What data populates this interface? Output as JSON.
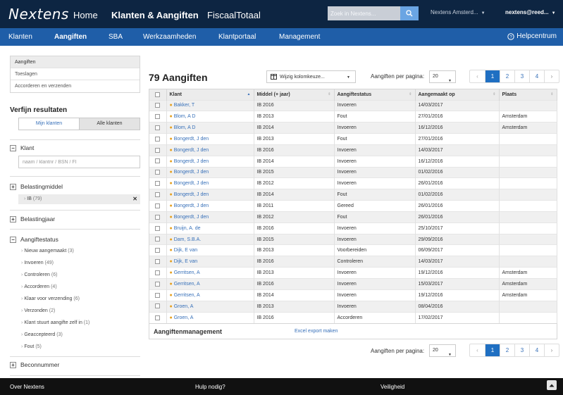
{
  "topbar": {
    "logo": "Nextens",
    "nav": [
      "Home",
      "Klanten & Aangiften",
      "FiscaalTotaal"
    ],
    "search_placeholder": "Zoek in Nextens...",
    "office": "Nextens Amsterd...",
    "user": "nextens@reed..."
  },
  "subnav": {
    "items": [
      "Klanten",
      "Aangiften",
      "SBA",
      "Werkzaamheden",
      "Klantportaal",
      "Management"
    ],
    "help": "Helpcentrum"
  },
  "sidebar": {
    "links": [
      "Aangiften",
      "Toeslagen",
      "Accorderen en verzenden"
    ],
    "refine_title": "Verfijn resultaten",
    "toggle": [
      "Mijn klanten",
      "Alle klanten"
    ],
    "facet_klant": "Klant",
    "klant_placeholder": "naam / klantnr / BSN / FI",
    "facet_belastingmiddel": "Belastingmiddel",
    "selected_filter": "IB",
    "selected_filter_count": "(79)",
    "facet_belastingjaar": "Belastingjaar",
    "facet_aangiftestatus": "Aangiftestatus",
    "statuses": [
      {
        "label": "Nieuw aangemaakt",
        "count": "(3)"
      },
      {
        "label": "Invoeren",
        "count": "(49)"
      },
      {
        "label": "Controleren",
        "count": "(6)"
      },
      {
        "label": "Accorderen",
        "count": "(4)"
      },
      {
        "label": "Klaar voor verzending",
        "count": "(6)"
      },
      {
        "label": "Verzonden",
        "count": "(2)"
      },
      {
        "label": "Klant stuurt aangifte zelf in",
        "count": "(1)"
      },
      {
        "label": "Geaccepteerd",
        "count": "(3)"
      },
      {
        "label": "Fout",
        "count": "(5)"
      }
    ],
    "facet_beconnummer": "Beconnummer"
  },
  "main": {
    "title": "79 Aangiften",
    "column_select": "Wijzig kolomkeuze...",
    "per_page_label": "Aangiften per pagina:",
    "per_page_value": "20",
    "pages": [
      "‹",
      "1",
      "2",
      "3",
      "4",
      "›"
    ],
    "columns": [
      "Klant",
      "Middel (+ jaar)",
      "Aangiftestatus",
      "Aangemaakt op",
      "Plaats"
    ],
    "rows": [
      [
        "Bakker, T",
        "IB 2016",
        "Invoeren",
        "14/03/2017",
        ""
      ],
      [
        "Blom, A D",
        "IB 2013",
        "Fout",
        "27/01/2016",
        "Amsterdam"
      ],
      [
        "Blom, A D",
        "IB 2014",
        "Invoeren",
        "16/12/2016",
        "Amsterdam"
      ],
      [
        "Bongerdt, J den",
        "IB 2013",
        "Fout",
        "27/01/2016",
        ""
      ],
      [
        "Bongerdt, J den",
        "IB 2016",
        "Invoeren",
        "14/03/2017",
        ""
      ],
      [
        "Bongerdt, J den",
        "IB 2014",
        "Invoeren",
        "16/12/2016",
        ""
      ],
      [
        "Bongerdt, J den",
        "IB 2015",
        "Invoeren",
        "01/02/2016",
        ""
      ],
      [
        "Bongerdt, J den",
        "IB 2012",
        "Invoeren",
        "26/01/2016",
        ""
      ],
      [
        "Bongerdt, J den",
        "IB 2014",
        "Fout",
        "01/02/2016",
        ""
      ],
      [
        "Bongerdt, J den",
        "IB 2011",
        "Gereed",
        "26/01/2016",
        ""
      ],
      [
        "Bongerdt, J den",
        "IB 2012",
        "Fout",
        "26/01/2016",
        ""
      ],
      [
        "Bruijn, A. de",
        "IB 2016",
        "Invoeren",
        "25/10/2017",
        ""
      ],
      [
        "Dam, S.B.A.",
        "IB 2015",
        "Invoeren",
        "29/09/2016",
        ""
      ],
      [
        "Dijk, E van",
        "IB 2013",
        "Voorbereiden",
        "06/09/2017",
        ""
      ],
      [
        "Dijk, E van",
        "IB 2016",
        "Controleren",
        "14/03/2017",
        ""
      ],
      [
        "Gerritsen, A",
        "IB 2013",
        "Invoeren",
        "19/12/2016",
        "Amsterdam"
      ],
      [
        "Gerritsen, A",
        "IB 2016",
        "Invoeren",
        "15/03/2017",
        "Amsterdam"
      ],
      [
        "Gerritsen, A",
        "IB 2014",
        "Invoeren",
        "19/12/2016",
        "Amsterdam"
      ],
      [
        "Groen, A",
        "IB 2013",
        "Invoeren",
        "08/04/2016",
        ""
      ],
      [
        "Groen, A",
        "IB 2016",
        "Accorderen",
        "17/02/2017",
        ""
      ]
    ],
    "management_title": "Aangiftenmanagement",
    "export_link": "Excel export maken"
  },
  "footer": {
    "items": [
      "Over Nextens",
      "Hulp nodig?",
      "Veiligheid"
    ]
  }
}
